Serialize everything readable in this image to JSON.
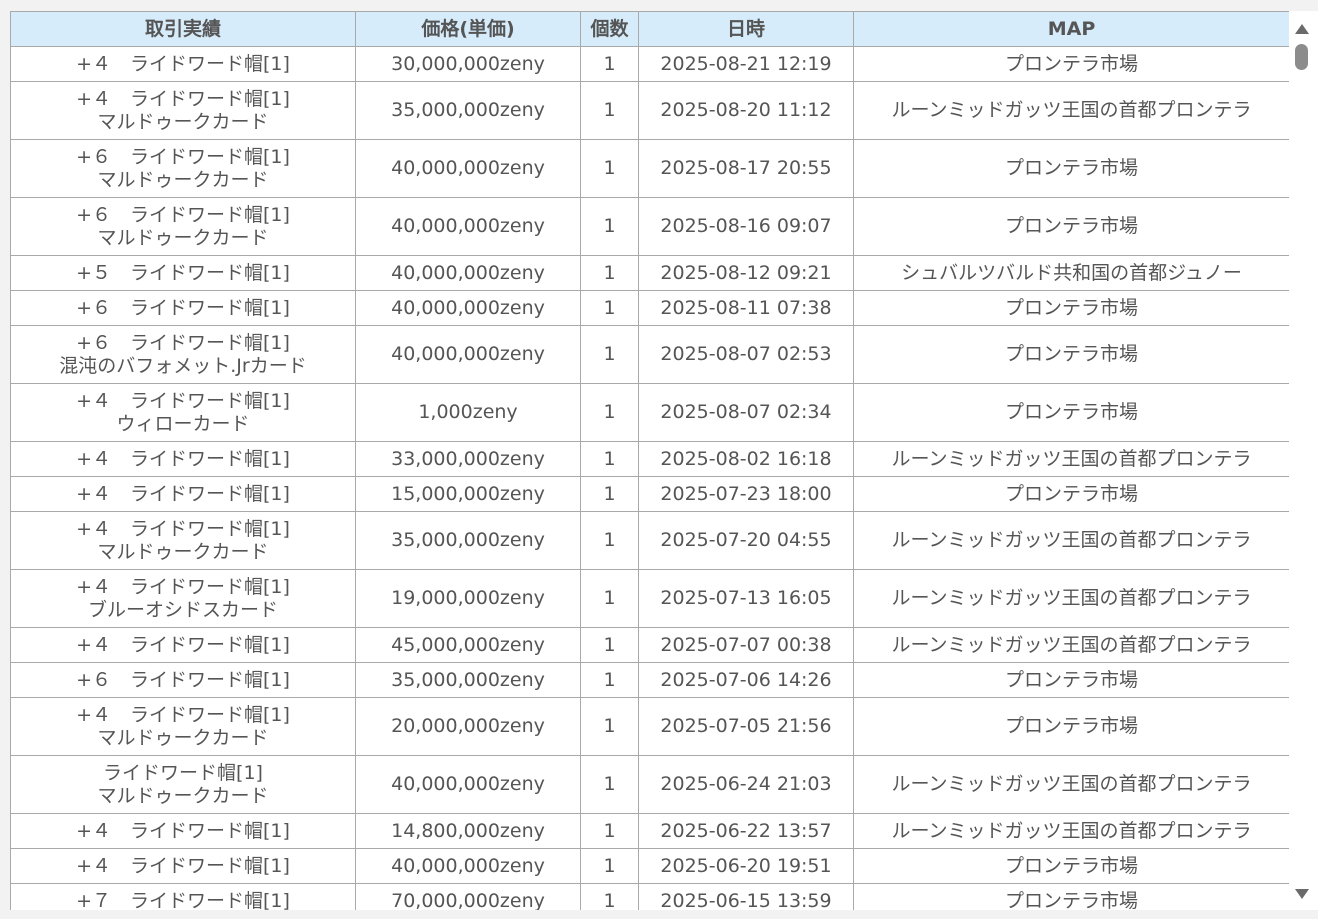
{
  "table": {
    "headers": [
      "取引実績",
      "価格(単価)",
      "個数",
      "日時",
      "MAP"
    ],
    "rows": [
      {
        "item": "+４　ライドワード帽[1]",
        "card": "",
        "price": "30,000,000zeny",
        "qty": "1",
        "datetime": "2025-08-21 12:19",
        "map": "プロンテラ市場"
      },
      {
        "item": "+４　ライドワード帽[1]",
        "card": "マルドゥークカード",
        "price": "35,000,000zeny",
        "qty": "1",
        "datetime": "2025-08-20 11:12",
        "map": "ルーンミッドガッツ王国の首都プロンテラ"
      },
      {
        "item": "+６　ライドワード帽[1]",
        "card": "マルドゥークカード",
        "price": "40,000,000zeny",
        "qty": "1",
        "datetime": "2025-08-17 20:55",
        "map": "プロンテラ市場"
      },
      {
        "item": "+６　ライドワード帽[1]",
        "card": "マルドゥークカード",
        "price": "40,000,000zeny",
        "qty": "1",
        "datetime": "2025-08-16 09:07",
        "map": "プロンテラ市場"
      },
      {
        "item": "+５　ライドワード帽[1]",
        "card": "",
        "price": "40,000,000zeny",
        "qty": "1",
        "datetime": "2025-08-12 09:21",
        "map": "シュバルツバルド共和国の首都ジュノー"
      },
      {
        "item": "+６　ライドワード帽[1]",
        "card": "",
        "price": "40,000,000zeny",
        "qty": "1",
        "datetime": "2025-08-11 07:38",
        "map": "プロンテラ市場"
      },
      {
        "item": "+６　ライドワード帽[1]",
        "card": "混沌のバフォメット.Jrカード",
        "price": "40,000,000zeny",
        "qty": "1",
        "datetime": "2025-08-07 02:53",
        "map": "プロンテラ市場"
      },
      {
        "item": "+４　ライドワード帽[1]",
        "card": "ウィローカード",
        "price": "1,000zeny",
        "qty": "1",
        "datetime": "2025-08-07 02:34",
        "map": "プロンテラ市場"
      },
      {
        "item": "+４　ライドワード帽[1]",
        "card": "",
        "price": "33,000,000zeny",
        "qty": "1",
        "datetime": "2025-08-02 16:18",
        "map": "ルーンミッドガッツ王国の首都プロンテラ"
      },
      {
        "item": "+４　ライドワード帽[1]",
        "card": "",
        "price": "15,000,000zeny",
        "qty": "1",
        "datetime": "2025-07-23 18:00",
        "map": "プロンテラ市場"
      },
      {
        "item": "+４　ライドワード帽[1]",
        "card": "マルドゥークカード",
        "price": "35,000,000zeny",
        "qty": "1",
        "datetime": "2025-07-20 04:55",
        "map": "ルーンミッドガッツ王国の首都プロンテラ"
      },
      {
        "item": "+４　ライドワード帽[1]",
        "card": "ブルーオシドスカード",
        "price": "19,000,000zeny",
        "qty": "1",
        "datetime": "2025-07-13 16:05",
        "map": "ルーンミッドガッツ王国の首都プロンテラ"
      },
      {
        "item": "+４　ライドワード帽[1]",
        "card": "",
        "price": "45,000,000zeny",
        "qty": "1",
        "datetime": "2025-07-07 00:38",
        "map": "ルーンミッドガッツ王国の首都プロンテラ"
      },
      {
        "item": "+６　ライドワード帽[1]",
        "card": "",
        "price": "35,000,000zeny",
        "qty": "1",
        "datetime": "2025-07-06 14:26",
        "map": "プロンテラ市場"
      },
      {
        "item": "+４　ライドワード帽[1]",
        "card": "マルドゥークカード",
        "price": "20,000,000zeny",
        "qty": "1",
        "datetime": "2025-07-05 21:56",
        "map": "プロンテラ市場"
      },
      {
        "item": "ライドワード帽[1]",
        "card": "マルドゥークカード",
        "price": "40,000,000zeny",
        "qty": "1",
        "datetime": "2025-06-24 21:03",
        "map": "ルーンミッドガッツ王国の首都プロンテラ"
      },
      {
        "item": "+４　ライドワード帽[1]",
        "card": "",
        "price": "14,800,000zeny",
        "qty": "1",
        "datetime": "2025-06-22 13:57",
        "map": "ルーンミッドガッツ王国の首都プロンテラ"
      },
      {
        "item": "+４　ライドワード帽[1]",
        "card": "",
        "price": "40,000,000zeny",
        "qty": "1",
        "datetime": "2025-06-20 19:51",
        "map": "プロンテラ市場"
      },
      {
        "item": "+７　ライドワード帽[1]",
        "card": "",
        "price": "70,000,000zeny",
        "qty": "1",
        "datetime": "2025-06-15 13:59",
        "map": "プロンテラ市場"
      }
    ]
  },
  "scrollbar": {
    "up_icon": "triangle-up-icon",
    "down_icon": "triangle-down-icon"
  },
  "colors": {
    "header_bg": "#d6ecfb",
    "border": "#a9a9a9",
    "text": "#555555"
  }
}
